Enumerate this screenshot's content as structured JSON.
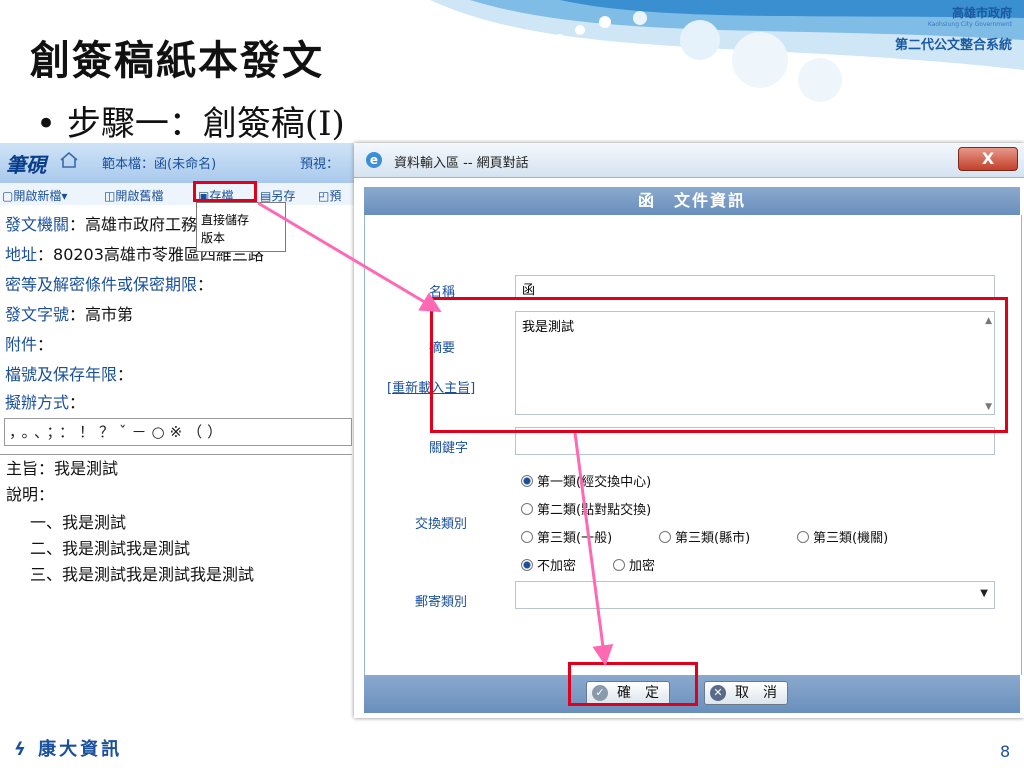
{
  "slide": {
    "title": "創簽稿紙本發文",
    "bullet": "• 步驟一：創簽稿(I)",
    "logo_line1": "高雄市政府",
    "logo_sub": "Kaohsiung City Government",
    "logo_line2": "第二代公文整合系統",
    "company": "康大資訊",
    "page_number": "8"
  },
  "editor": {
    "logo": "筆硯",
    "template_label": "範本檔：函(未命名)",
    "preview_label": "預視：",
    "toolbar": {
      "new": "開啟新檔▾",
      "open": "開啟舊檔",
      "save": "存檔",
      "save_as": "另存",
      "preview": "預"
    },
    "save_menu": {
      "direct_save": "直接儲存",
      "version": "版本"
    },
    "fields": [
      {
        "key": "發文機關",
        "value": "：高雄市政府工務局新建工"
      },
      {
        "key": "地址",
        "value": "：80203高雄市苓雅區四維三路"
      },
      {
        "key": "密等及解密條件或保密期限",
        "value": "："
      },
      {
        "key": "發文字號",
        "value": "：高市第"
      },
      {
        "key": "附件",
        "value": "："
      },
      {
        "key": "檔號及保存年限",
        "value": "："
      },
      {
        "key": "擬辦方式",
        "value": "："
      }
    ],
    "punctuation": "，。、；：！？ˇ－○※（）",
    "body": {
      "subject": "主旨：我是測試",
      "description_label": "說明：",
      "items": [
        "一、我是測試",
        "二、我是測試我是測試",
        "三、我是測試我是測試我是測試"
      ]
    }
  },
  "dialog": {
    "title": "資料輸入區 -- 網頁對話",
    "close_symbol": "X",
    "header": "函　文件資訊",
    "name_label": "名稱",
    "name_value": "函",
    "abstract_label": "摘要",
    "abstract_value": "我是測試",
    "reload_link": "[重新載入主旨]",
    "keyword_label": "關鍵字",
    "keyword_value": "",
    "exchange_label": "交換類別",
    "exchange_options": [
      {
        "label": "第一類(經交換中心)",
        "selected": true
      },
      {
        "label": "第二類(點對點交換)",
        "selected": false
      },
      {
        "label": "第三類(一般)",
        "selected": false
      },
      {
        "label": "第三類(縣市)",
        "selected": false
      },
      {
        "label": "第三類(機關)",
        "selected": false
      }
    ],
    "encrypt_options": [
      {
        "label": "不加密",
        "selected": true
      },
      {
        "label": "加密",
        "selected": false
      }
    ],
    "mail_label": "郵寄類別",
    "mail_value": "",
    "confirm_label": "確　定",
    "cancel_label": "取　消"
  },
  "colors": {
    "highlight": "#e0001b",
    "arrow": "#ff69b4",
    "accent": "#1a4f9c"
  }
}
